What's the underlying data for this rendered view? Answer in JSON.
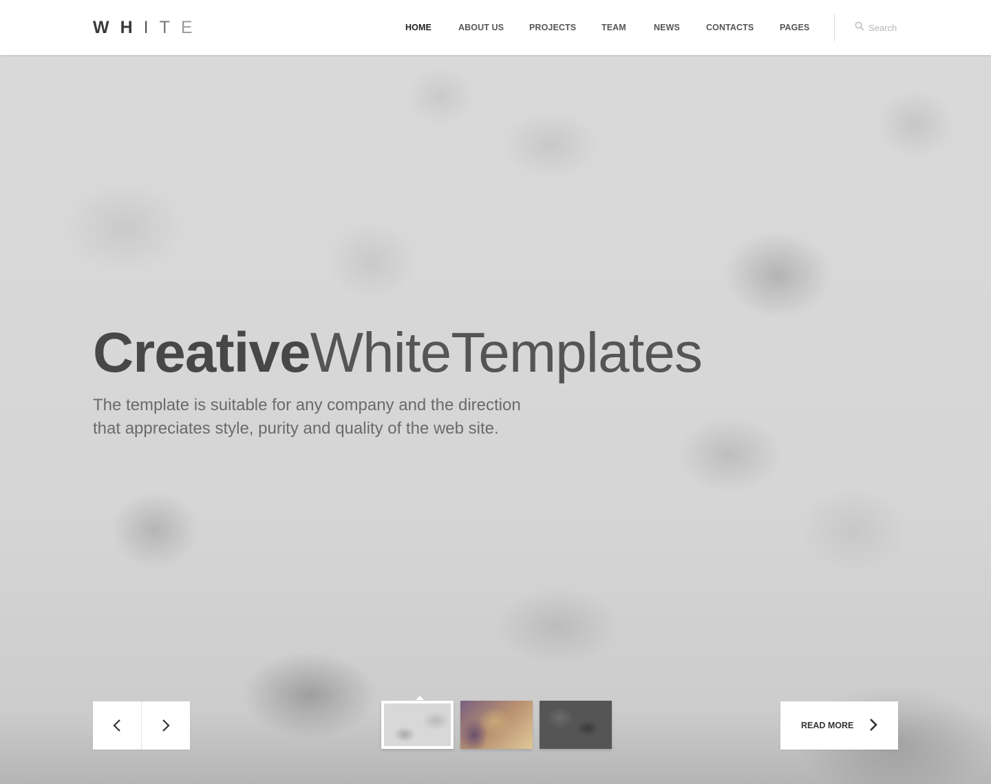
{
  "header": {
    "logo_letters": [
      "W",
      "H",
      "I",
      "T",
      "E"
    ],
    "nav": [
      {
        "label": "HOME",
        "active": true
      },
      {
        "label": "ABOUT US",
        "active": false
      },
      {
        "label": "PROJECTS",
        "active": false
      },
      {
        "label": "TEAM",
        "active": false
      },
      {
        "label": "NEWS",
        "active": false
      },
      {
        "label": "CONTACTS",
        "active": false
      },
      {
        "label": "PAGES",
        "active": false
      }
    ],
    "search": {
      "placeholder": "Search",
      "icon": "search-icon"
    }
  },
  "hero": {
    "headline_bold": "Creative",
    "headline_light_1": "White",
    "headline_light_2": "Templates",
    "subtitle_line1": "The template is suitable for any company and the direction",
    "subtitle_line2": "that appreciates style, purity and quality of the web site.",
    "controls": {
      "prev_icon": "chevron-left-icon",
      "next_icon": "chevron-right-icon",
      "read_more_label": "READ MORE",
      "read_more_icon": "chevron-right-icon"
    },
    "thumbnails": [
      {
        "name": "slide-1",
        "active": true
      },
      {
        "name": "slide-2",
        "active": false
      },
      {
        "name": "slide-3",
        "active": false
      }
    ]
  },
  "colors": {
    "header_bg": "#ffffff",
    "text_dark": "#444444",
    "nav_text": "#555555",
    "hero_bg": "#d9d9d9"
  }
}
